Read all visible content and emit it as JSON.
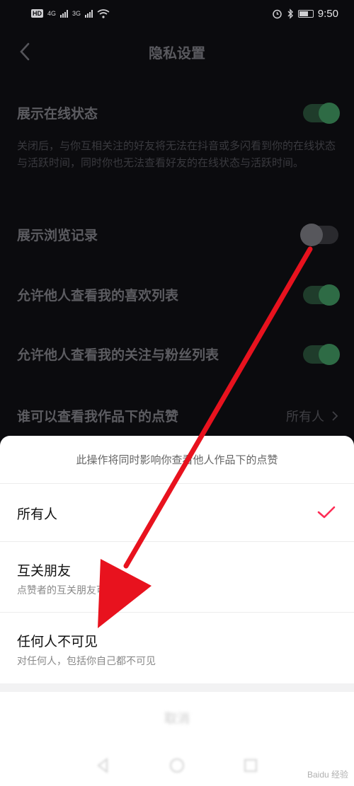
{
  "status_bar": {
    "hd": "HD",
    "net1": "4G",
    "net2": "3G",
    "time": "9:50"
  },
  "nav": {
    "title": "隐私设置"
  },
  "settings": {
    "online": {
      "label": "展示在线状态",
      "on": true,
      "desc": "关闭后，与你互相关注的好友将无法在抖音或多闪看到你的在线状态与活跃时间，同时你也无法查看好友的在线状态与活跃时间。"
    },
    "history": {
      "label": "展示浏览记录",
      "on": false
    },
    "likes": {
      "label": "允许他人查看我的喜欢列表",
      "on": true
    },
    "follows": {
      "label": "允许他人查看我的关注与粉丝列表",
      "on": true
    },
    "like_visibility": {
      "label": "谁可以查看我作品下的点赞",
      "value": "所有人"
    }
  },
  "sheet": {
    "hint": "此操作将同时影响你查看他人作品下的点赞",
    "options": [
      {
        "title": "所有人",
        "subtitle": "",
        "selected": true
      },
      {
        "title": "互关朋友",
        "subtitle": "点赞者的互关朋友可见",
        "selected": false
      },
      {
        "title": "任何人不可见",
        "subtitle": "对任何人，包括你自己都不可见",
        "selected": false
      }
    ],
    "cancel": "取消"
  },
  "colors": {
    "accent": "#fe2c55",
    "toggle_on": "#2e6b45",
    "arrow": "#e8121e"
  },
  "watermark": "Baidu 经验"
}
